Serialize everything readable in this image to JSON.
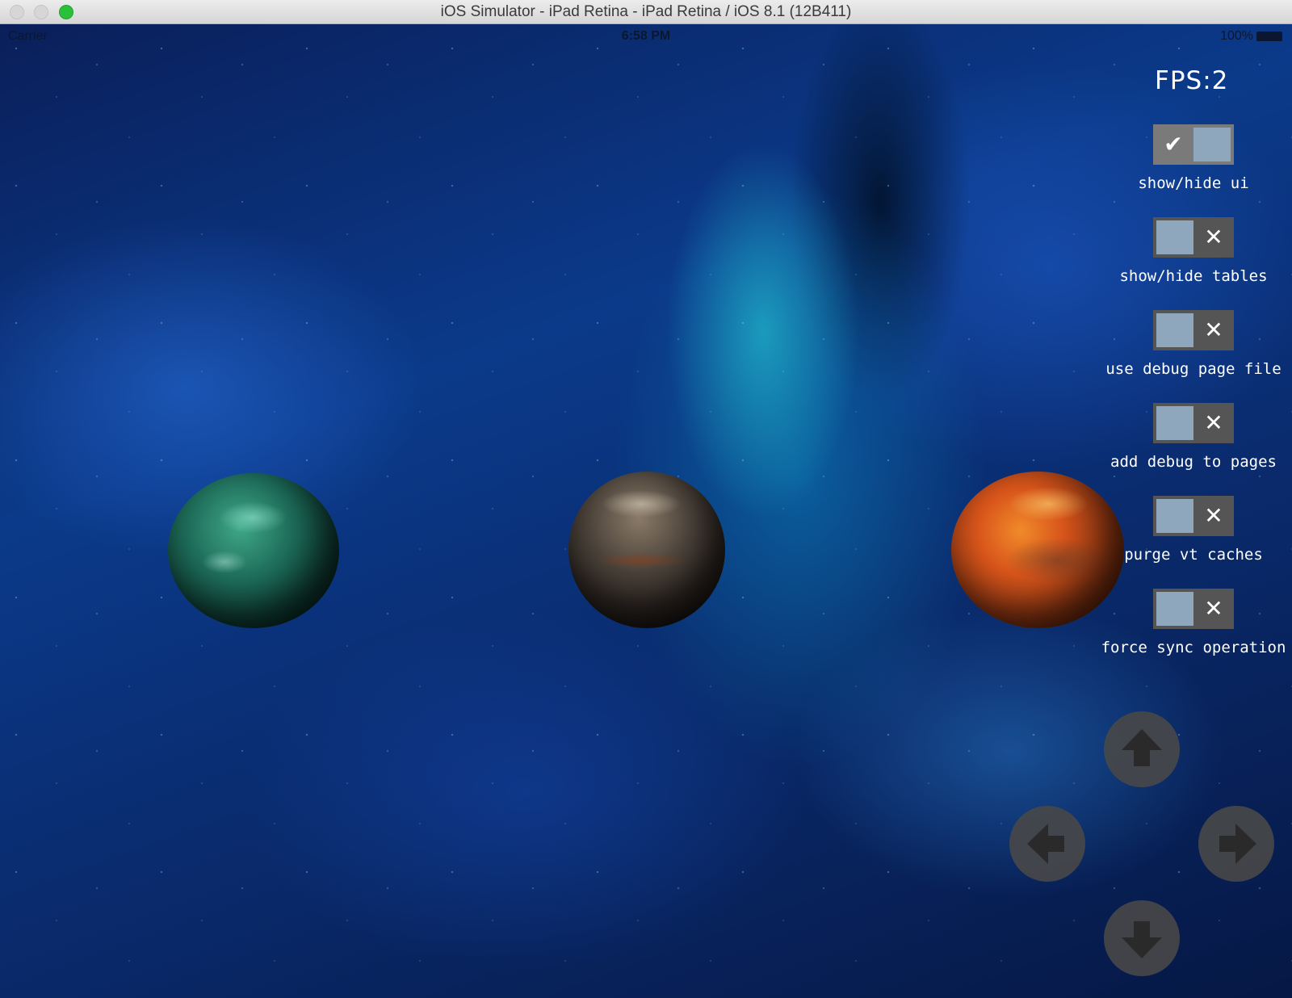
{
  "window": {
    "title": "iOS Simulator - iPad Retina - iPad Retina / iOS 8.1 (12B411)"
  },
  "status_bar": {
    "carrier": "Carrier",
    "time": "6:58 PM",
    "battery": "100%"
  },
  "hud": {
    "fps": "FPS:2"
  },
  "options": [
    {
      "label": "show/hide ui",
      "state": "on",
      "mark": "✔"
    },
    {
      "label": "show/hide tables",
      "state": "off",
      "mark": "✕"
    },
    {
      "label": "use debug page file",
      "state": "off",
      "mark": "✕"
    },
    {
      "label": "add debug to pages",
      "state": "off",
      "mark": "✕"
    },
    {
      "label": "purge vt caches",
      "state": "off",
      "mark": "✕"
    },
    {
      "label": "force sync operation",
      "state": "off",
      "mark": "✕"
    }
  ],
  "dpad": {
    "up": "arrow-up-icon",
    "left": "arrow-left-icon",
    "right": "arrow-right-icon",
    "down": "arrow-down-icon",
    "color": "#484848"
  },
  "planets": [
    "green planet",
    "rocky planet",
    "orange planet"
  ]
}
